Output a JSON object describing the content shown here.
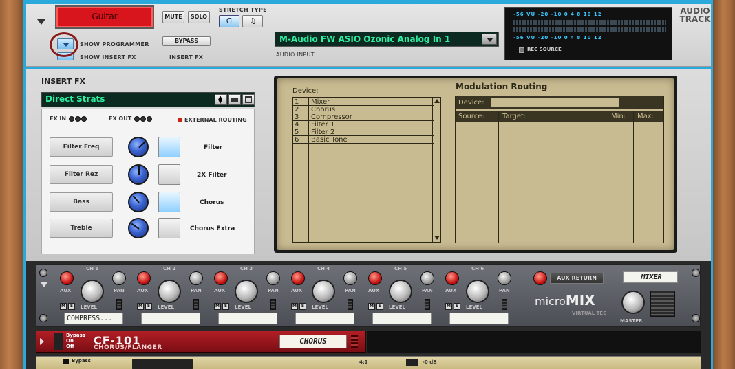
{
  "colors": {
    "frame_blue": "#2aa9dc",
    "track_red": "#d8141c",
    "lcd_bg": "#c9bb91",
    "display_green": "#2ef0a0",
    "rack_red": "#b31e26"
  },
  "track": {
    "name": "Guitar",
    "mute_label": "MUTE",
    "solo_label": "SOLO",
    "stretch_type_label": "STRETCH TYPE",
    "stretch_opt1": "ᗡ",
    "stretch_opt2": "♫",
    "show_programmer_label": "SHOW PROGRAMMER",
    "show_insert_fx_label": "SHOW INSERT FX",
    "bypass_label": "BYPASS",
    "insert_fx_label": "INSERT FX",
    "audio_input_value": "M-Audio FW ASIO Ozonic Analog In 1",
    "audio_input_label": "AUDIO INPUT",
    "vu_label": "VU",
    "vu_scale_top": "-56  VU  -20  -10    0   4  8 10 12",
    "vu_scale_bottom": "-56  VU  -20  -10    0   4  8 10 12",
    "rec_source_label": "REC SOURCE",
    "title_line1": "AUDIO",
    "title_line2": "TRACK"
  },
  "insert_fx": {
    "title": "INSERT FX",
    "patch_name": "Direct Strats",
    "fx_in_label": "FX IN",
    "fx_out_label": "FX OUT",
    "external_routing_label": "EXTERNAL ROUTING",
    "params": [
      {
        "label": "Filter Freq",
        "button_label": "Filter",
        "button_on": true
      },
      {
        "label": "Filter Rez",
        "button_label": "2X Filter",
        "button_on": false
      },
      {
        "label": "Bass",
        "button_label": "Chorus",
        "button_on": true
      },
      {
        "label": "Treble",
        "button_label": "Chorus Extra",
        "button_on": false
      }
    ]
  },
  "lcd": {
    "device_label": "Device:",
    "devices": [
      {
        "num": "1",
        "name": "Mixer"
      },
      {
        "num": "2",
        "name": "Chorus"
      },
      {
        "num": "3",
        "name": "Compressor"
      },
      {
        "num": "4",
        "name": "Filter 1"
      },
      {
        "num": "5",
        "name": "Filter 2"
      },
      {
        "num": "6",
        "name": "Basic Tone"
      }
    ],
    "mod_title": "Modulation Routing",
    "mod_device_label": "Device:",
    "col_source": "Source:",
    "col_target": "Target:",
    "col_min": "Min:",
    "col_max": "Max:"
  },
  "mixer": {
    "channels": [
      {
        "label": "CH 1",
        "tape": "COMPRESS..."
      },
      {
        "label": "CH 2",
        "tape": ""
      },
      {
        "label": "CH 3",
        "tape": ""
      },
      {
        "label": "CH 4",
        "tape": ""
      },
      {
        "label": "CH 5",
        "tape": ""
      },
      {
        "label": "CH 6",
        "tape": ""
      }
    ],
    "aux_label": "AUX",
    "pan_label": "PAN",
    "level_label": "LEVEL",
    "m_label": "M",
    "s_label": "S",
    "aux_return_label": "AUX RETURN",
    "mixer_tape": "MIXER",
    "brand_micro": "micro",
    "brand_mix": "MIX",
    "brand_sub": "VIRTUAL TEC",
    "master_label": "MASTER"
  },
  "cf101": {
    "bypass_label": "Bypass",
    "on_label": "On",
    "off_label": "Off",
    "title": "CF-101",
    "subtitle": "CHORUS/FLANGER",
    "tape": "CHORUS"
  },
  "mclass": {
    "bypass_label": "Bypass",
    "ratio": "4:1",
    "gain": "-0 dB"
  }
}
